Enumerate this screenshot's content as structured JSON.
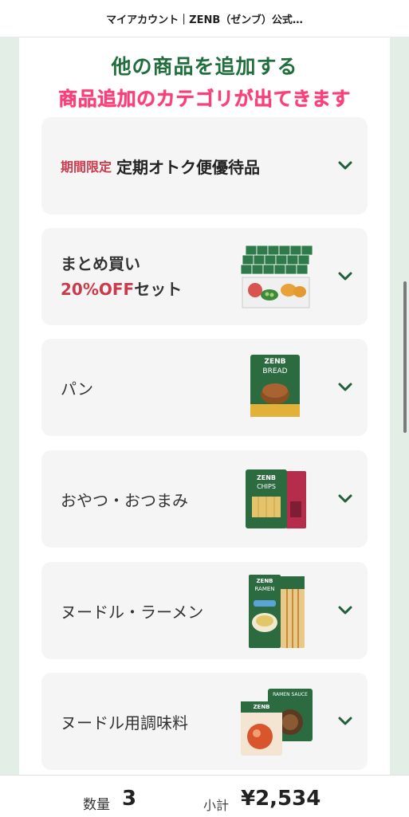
{
  "header": {
    "title": "マイアカウント｜ZENB（ゼンブ）公式…"
  },
  "section": {
    "title": "他の商品を追加する",
    "subtitle": "商品追加のカテゴリが出てきます"
  },
  "categories": [
    {
      "tag": "期間限定",
      "label": "定期オトク便優待品"
    },
    {
      "line1": "まとめ買い",
      "line2_red": "20%OFF",
      "line2_rest": "セット"
    },
    {
      "label": "パン"
    },
    {
      "label": "おやつ・おつまみ"
    },
    {
      "label": "ヌードル・ラーメン"
    },
    {
      "label": "ヌードル用調味料"
    }
  ],
  "product_images": {
    "bread": {
      "brand": "ZENB",
      "name": "BREAD"
    },
    "chips": {
      "brand": "ZENB",
      "name": "CHIPS"
    },
    "ramen": {
      "brand": "ZENB",
      "name": "RAMEN"
    },
    "sauce": {
      "brand": "ZENB",
      "name": "RAMEN SAUCE"
    }
  },
  "footer": {
    "qty_label": "数量",
    "qty_value": "3",
    "subtotal_label": "小計",
    "subtotal_value": "¥2,534"
  },
  "colors": {
    "accent_green": "#1f6e3c",
    "accent_pink": "#ff3d7a",
    "accent_red": "#cc3b4c",
    "page_bg": "#e3efe6"
  }
}
